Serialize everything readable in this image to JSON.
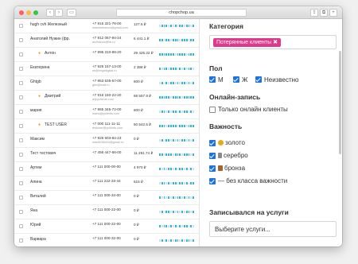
{
  "browser": {
    "url": "chopchop.ua",
    "back": "‹",
    "forward": "›",
    "sidebar": "▭",
    "share": "⇪",
    "tabs": "⧉",
    "new_tab": "+"
  },
  "customers": [
    {
      "name": "hugh cvh Железный",
      "phone": "+7 915 321-78-00",
      "email": "maxshebanov@gmail.com",
      "amount": "127.5 ₽",
      "visits": "0111010101101101",
      "vip": false
    },
    {
      "name": "Анатолий Нужин (фр.",
      "phone": "+7 912 067-94-24",
      "email": "anzhanov@bk.ru",
      "amount": "6 441.1 ₽",
      "visits": "1101101110111011",
      "vip": false
    },
    {
      "name": "Антон",
      "phone": "+7 995 310-89-20",
      "email": "",
      "amount": "29 425.22 ₽",
      "visits": "1111111011110111",
      "vip": true
    },
    {
      "name": "Екатерина",
      "phone": "+7 925 157-13-00",
      "email": "eb@ringsdigital.ru",
      "amount": "2 388 ₽",
      "visits": "1011011101010110",
      "vip": false
    },
    {
      "name": "Ghtgb",
      "phone": "+7 953 535-57-00",
      "email": "ghe@mail.ru",
      "amount": "600 ₽",
      "visits": "0101011010110101",
      "vip": false
    },
    {
      "name": "Дмитрий",
      "phone": "+7 916 150-22-20",
      "email": "d@yclients.com",
      "amount": "68 557.9 ₽",
      "visits": "1111101111011111",
      "vip": true
    },
    {
      "name": "мария",
      "phone": "+7 965 345-72-00",
      "email": "maria@yclients.com",
      "amount": "600 ₽",
      "visits": "0110101101011010",
      "vip": false
    },
    {
      "name": "TEST USER",
      "phone": "+7 000 111-11-11",
      "email": "testuser@yclients.com",
      "amount": "50 542.5 ₽",
      "visits": "1110111101110111",
      "vip": true
    },
    {
      "name": "Максим",
      "phone": "+7 926 503-84-23",
      "email": "max5038423@gmail.ru",
      "amount": "0 ₽",
      "visits": "0101101010110101",
      "vip": false
    },
    {
      "name": "Тест тестович",
      "phone": "+7 456 447-66-00",
      "email": "",
      "amount": "11 291.74 ₽",
      "visits": "1101110111011101",
      "vip": false
    },
    {
      "name": "Артем",
      "phone": "+7 111 000-00-00",
      "email": "",
      "amount": "4 970 ₽",
      "visits": "1010110101101010",
      "vip": false
    },
    {
      "name": "Алина",
      "phone": "+7 111 222-33-44",
      "email": "",
      "amount": "615 ₽",
      "visits": "0110101101101011",
      "vip": false
    },
    {
      "name": "Виталий",
      "phone": "+7 111 000-34-00",
      "email": "",
      "amount": "0 ₽",
      "visits": "1010101011010101",
      "vip": false
    },
    {
      "name": "Яна",
      "phone": "+7 111 000-22-00",
      "email": "",
      "amount": "0 ₽",
      "visits": "0101101010101101",
      "vip": false
    },
    {
      "name": "Юрий",
      "phone": "+7 111 000-22-00",
      "email": "",
      "amount": "0 ₽",
      "visits": "1011010101011010",
      "vip": false
    },
    {
      "name": "Варвара",
      "phone": "+7 111 000-32-00",
      "email": "",
      "amount": "0 ₽",
      "visits": "0101010110101101",
      "vip": false
    },
    {
      "name": "Дарья",
      "phone": "+7 123 456-78-90",
      "email": "",
      "amount": "285 ₽",
      "visits": "1101011010110101",
      "vip": false
    }
  ],
  "filters": {
    "category": {
      "title": "Категория",
      "tag": "Потерянные клиенты",
      "remove": "✖"
    },
    "gender": {
      "title": "Пол",
      "options": [
        {
          "label": "М",
          "checked": true
        },
        {
          "label": "Ж",
          "checked": true
        },
        {
          "label": "Неизвестно",
          "checked": true
        }
      ]
    },
    "online": {
      "title": "Онлайн-запись",
      "option": {
        "label": "Только онлайн клиенты",
        "checked": false
      }
    },
    "importance": {
      "title": "Важность",
      "options": [
        {
          "label": "золото",
          "checked": true,
          "medal": "gold-medal-icon"
        },
        {
          "label": "серебро",
          "checked": true,
          "medal": "silver-medal-icon"
        },
        {
          "label": "бронза",
          "checked": true,
          "medal": "bronze-medal-icon"
        },
        {
          "label": "— без класса важности",
          "checked": true,
          "medal": ""
        }
      ]
    },
    "services": {
      "title": "Записывался на услуги",
      "placeholder": "Выберите услуги..."
    }
  },
  "colors": {
    "accent": "#1a73e8",
    "tag": "#e0398c",
    "visit_on": "#34b5d3",
    "visit_off": "#c8e6ef"
  }
}
